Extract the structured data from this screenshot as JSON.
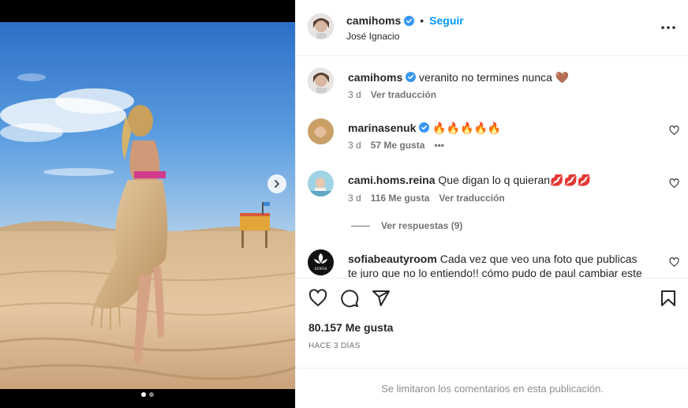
{
  "post": {
    "username": "camihoms",
    "follow_label": "Seguir",
    "bullet": "•",
    "location": "José Ignacio"
  },
  "caption": {
    "username": "camihoms",
    "text": "veranito no termines nunca 🤎",
    "time": "3 d",
    "translate": "Ver traducción"
  },
  "comments": [
    {
      "username": "marinasenuk",
      "text": "🔥🔥🔥🔥🔥",
      "time": "3 d",
      "likes": "57 Me gusta",
      "more": "•••"
    },
    {
      "username": "cami.homs.reina",
      "text": "Que digan lo q quieran💋💋💋",
      "time": "3 d",
      "likes": "116 Me gusta",
      "translate": "Ver traducción",
      "replies": "Ver respuestas (9)"
    },
    {
      "username": "sofiabeautyroom",
      "text": "Cada vez que veo una foto que publicas te juro que no lo entiendo!! cómo pudo de paul cambiar este",
      "avatar_text": "SOFIA"
    }
  ],
  "likes_total": "80.157 Me gusta",
  "time_ago": "HACE 3 DÍAS",
  "footer": "Se limitaron los comentarios en esta publicación.",
  "colors": {
    "link": "#0095f6",
    "verified": "#3897f0",
    "muted": "#737373",
    "border": "#efefef"
  },
  "carousel": {
    "total_slides": 2,
    "active_slide": 1
  }
}
